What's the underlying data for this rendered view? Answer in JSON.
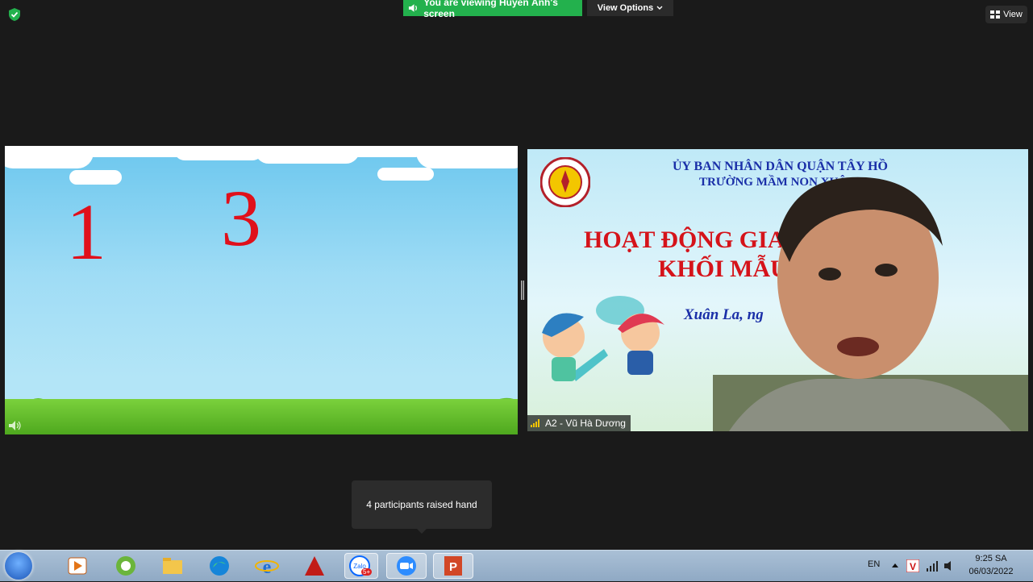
{
  "top_bar": {
    "viewing_text": "You are viewing Huyền Ánh's screen",
    "view_options_label": "View Options",
    "view_label": "View"
  },
  "left_panel": {
    "numbers": [
      "1",
      "3"
    ]
  },
  "right_panel": {
    "slide_line1": "ỦY BAN NHÂN DÂN QUẬN TÂY HỒ",
    "slide_line2": "TRƯỜNG MẦM NON XUÂN",
    "slide_title_line1": "HOẠT ĐỘNG GIA           T NỐI",
    "slide_title_line2": "KHỐI MẪU",
    "slide_date": "Xuân La, ng",
    "participant_name": "A2 - Vũ Hà Dương"
  },
  "tooltip": {
    "text": "4 participants raised hand"
  },
  "taskbar": {
    "language": "EN",
    "time": "9:25 SA",
    "date": "06/03/2022",
    "zalo_badge": "5+",
    "icons": [
      "windows-start-icon",
      "media-player-icon",
      "coc-coc-browser-icon",
      "file-explorer-icon",
      "edge-icon",
      "internet-explorer-icon",
      "autocad-icon",
      "zalo-icon",
      "zoom-icon",
      "powerpoint-icon"
    ]
  },
  "colors": {
    "banner_green": "#23b14d",
    "number_red": "#e0101b",
    "slide_blue": "#1a2fa8",
    "slide_red": "#d5131a"
  }
}
